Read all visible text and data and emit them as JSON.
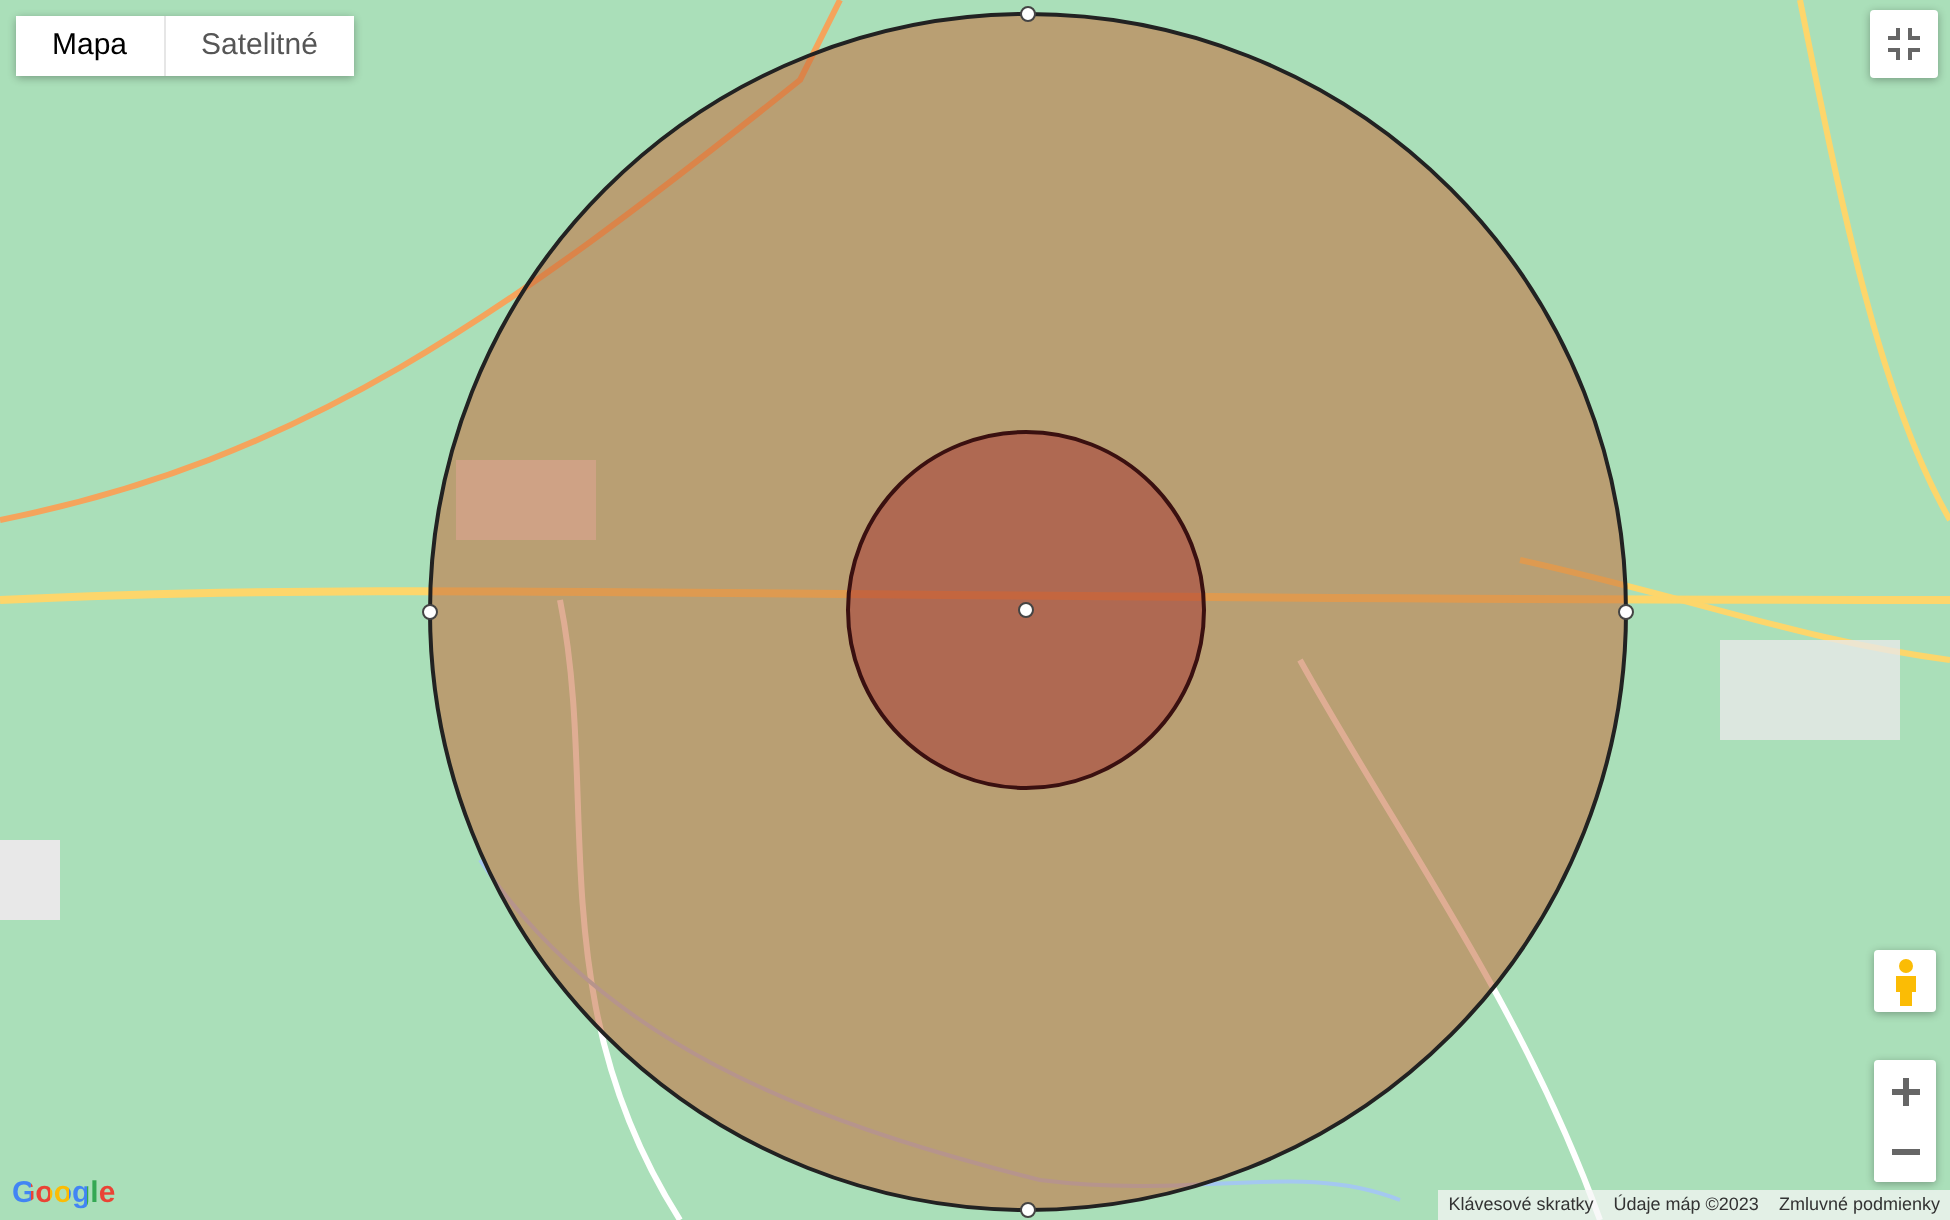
{
  "map_type_tabs": [
    {
      "label": "Mapa",
      "selected": true
    },
    {
      "label": "Satelitné",
      "selected": false
    }
  ],
  "logo": "Google",
  "footer_links": [
    "Klávesové skratky",
    "Údaje máp ©2023",
    "Zmluvné podmienky"
  ]
}
